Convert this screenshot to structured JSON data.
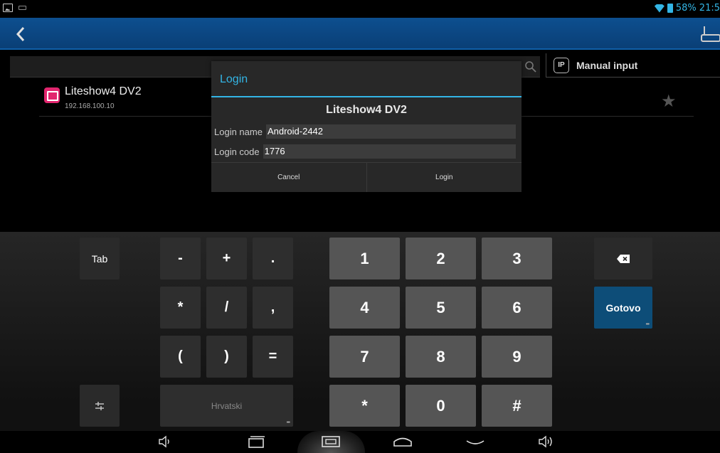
{
  "status_bar": {
    "battery": "58%",
    "time": "21:5"
  },
  "icons": {
    "back": "back-arrow-icon",
    "device": "router-icon",
    "search": "search-icon",
    "star": "star-icon",
    "backspace": "backspace-icon",
    "settings": "keyboard-settings-icon"
  },
  "search": {
    "manual_ip_badge": "IP",
    "manual_label": "Manual input"
  },
  "device_list": [
    {
      "name": "Liteshow4 DV2",
      "ip": "192.168.100.10"
    }
  ],
  "dialog": {
    "title": "Login",
    "device_name": "Liteshow4 DV2",
    "login_name_label": "Login name",
    "login_name_value": "Android-2442",
    "login_code_label": "Login code",
    "login_code_value": "1776",
    "cancel_label": "Cancel",
    "login_label": "Login"
  },
  "keyboard": {
    "tab": "Tab",
    "done": "Gotovo",
    "language": "Hrvatski",
    "symbols": [
      "-",
      "+",
      ".",
      "*",
      "/",
      ",",
      "(",
      ")",
      "="
    ],
    "digits": [
      "1",
      "2",
      "3",
      "4",
      "5",
      "6",
      "7",
      "8",
      "9",
      "*",
      "0",
      "#"
    ]
  },
  "colors": {
    "accent": "#33b5e5",
    "action_bar": "#0d4f8f",
    "done_key": "#0d4d78"
  }
}
